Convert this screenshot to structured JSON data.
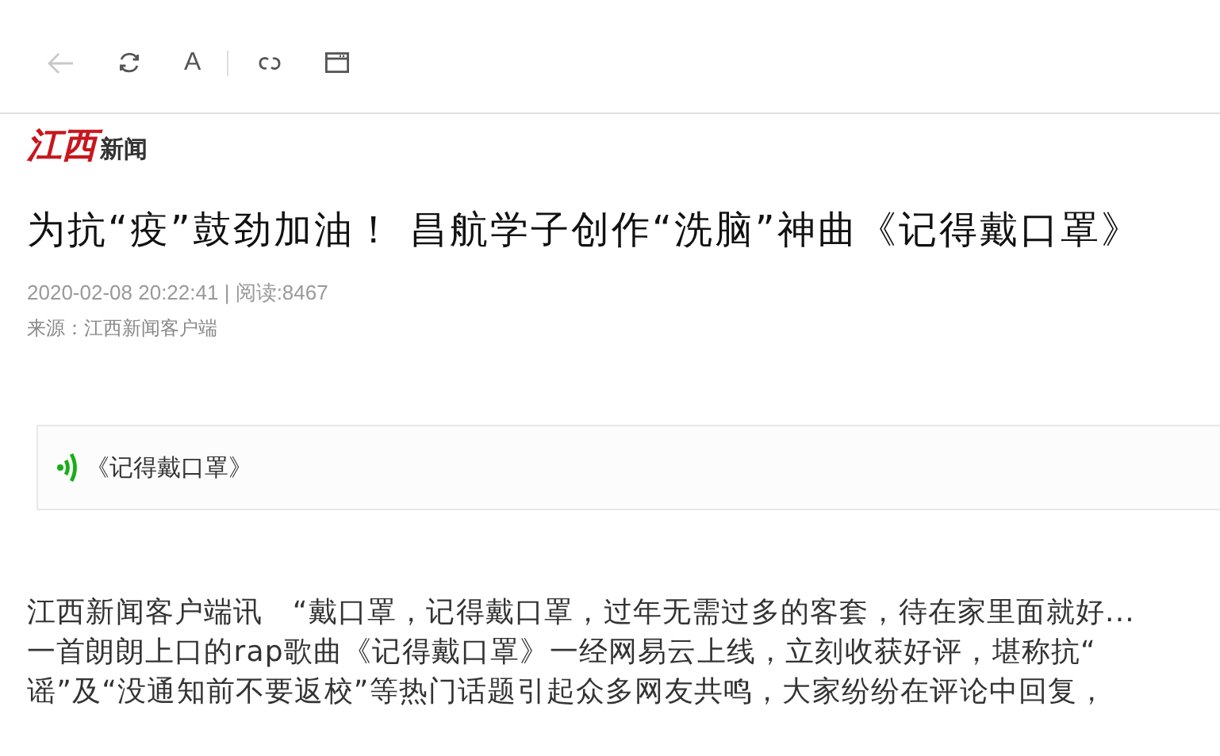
{
  "toolbar": {
    "back_disabled": true,
    "font_label": "A"
  },
  "logo": {
    "red": "江西",
    "black": "新闻"
  },
  "article": {
    "title": "为抗“疫”鼓劲加油！ 昌航学子创作“洗脑”神曲《记得戴口罩》",
    "meta": "2020-02-08 20:22:41 | 阅读:8467",
    "source": "来源：江西新闻客户端",
    "audio": {
      "title": "《记得戴口罩》"
    },
    "body_lines": [
      "江西新闻客户端讯　“戴口罩，记得戴口罩，过年无需过多的客套，待在家里面就好...",
      "一首朗朗上口的rap歌曲《记得戴口罩》一经网易云上线，立刻收获好评，堪称抗“",
      "谣”及“没通知前不要返校”等热门话题引起众多网友共鸣，大家纷纷在评论中回复，"
    ]
  }
}
